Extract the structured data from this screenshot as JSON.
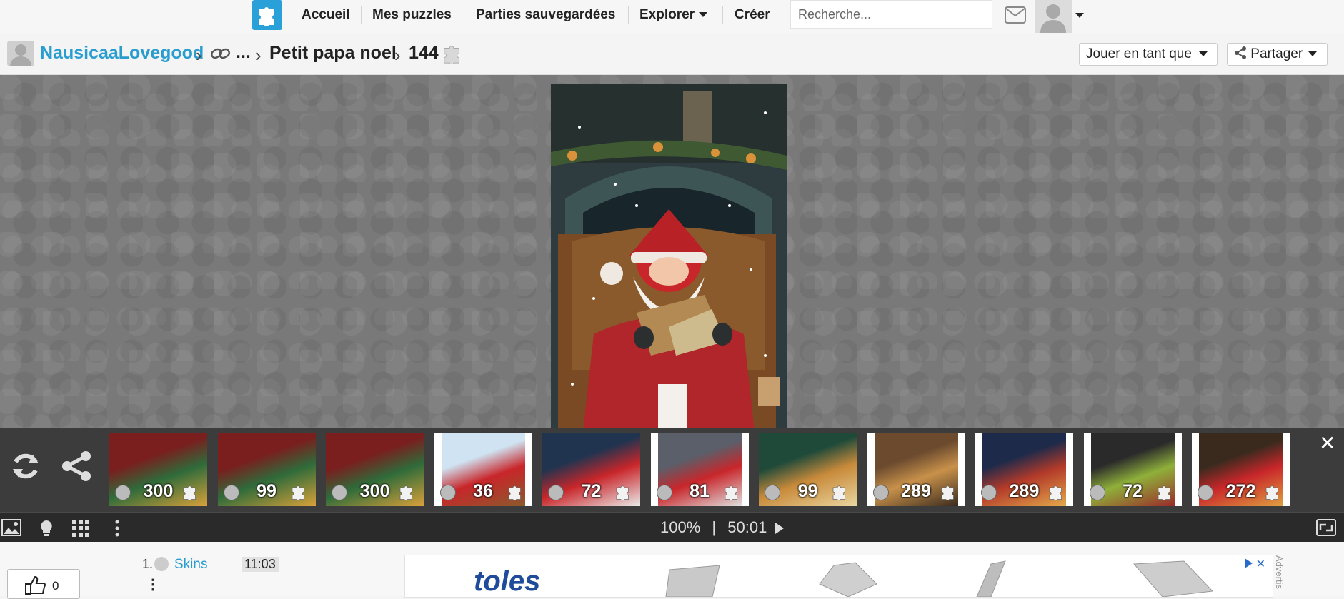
{
  "nav": {
    "items": [
      "Accueil",
      "Mes puzzles",
      "Parties sauvegardées",
      "Explorer",
      "Créer"
    ],
    "search_placeholder": "Recherche..."
  },
  "breadcrumb": {
    "user": "NausicaaLovegood",
    "ellipsis": "...",
    "title": "Petit papa noel",
    "piece_count": "144"
  },
  "actions": {
    "play_as": "Jouer en tant que",
    "share": "Partager"
  },
  "thumbnails": [
    {
      "count": "300",
      "style": "wide"
    },
    {
      "count": "99",
      "style": "wide"
    },
    {
      "count": "300",
      "style": "wide"
    },
    {
      "count": "36",
      "style": "narrow"
    },
    {
      "count": "72",
      "style": "wide"
    },
    {
      "count": "81",
      "style": "narrow"
    },
    {
      "count": "99",
      "style": "wide"
    },
    {
      "count": "289",
      "style": "narrow"
    },
    {
      "count": "289",
      "style": "narrow"
    },
    {
      "count": "72",
      "style": "narrow"
    },
    {
      "count": "272",
      "style": "narrow"
    }
  ],
  "status": {
    "zoom": "100%",
    "separator": "|",
    "timer": "50:01"
  },
  "lower": {
    "likes": "0",
    "rank": "1.",
    "rank_name": "Skins",
    "rank_time": "11:03"
  },
  "ad": {
    "logo_text": "toles",
    "side_label": "Advertis"
  },
  "colors": {
    "brand": "#2aa0d8",
    "link": "#2a9dd0",
    "stage": "#797979",
    "strip": "#3c3c3c",
    "toolbar": "#2a2a2a"
  }
}
